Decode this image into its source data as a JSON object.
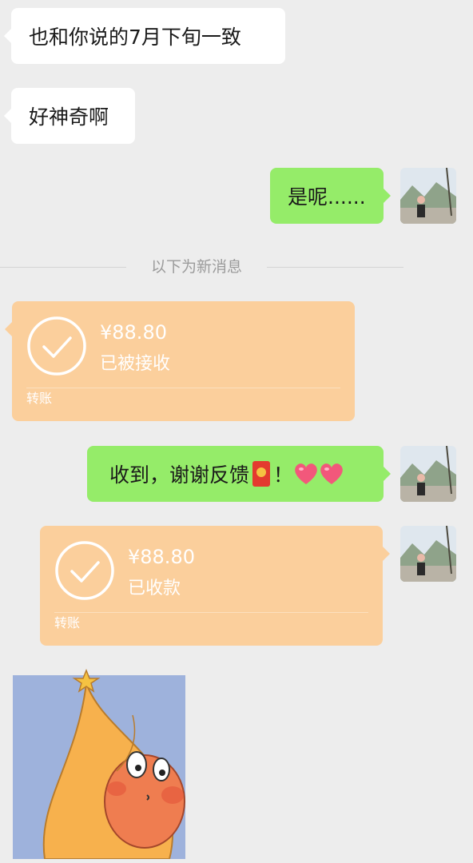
{
  "messages": {
    "m1": "也和你说的7月下旬一致",
    "m2": "好神奇啊",
    "m3": "是呢......",
    "divider": "以下为新消息",
    "m5_text": "收到，谢谢反馈",
    "m5_suffix": "！"
  },
  "transfer_received": {
    "amount": "¥88.80",
    "status": "已被接收",
    "kind": "转账"
  },
  "transfer_collected": {
    "amount": "¥88.80",
    "status": "已收款",
    "kind": "转账"
  },
  "colors": {
    "chat_bg": "#ededed",
    "incoming_bubble": "#ffffff",
    "outgoing_bubble": "#95ec69",
    "transfer_bubble": "#fbcf9c"
  }
}
